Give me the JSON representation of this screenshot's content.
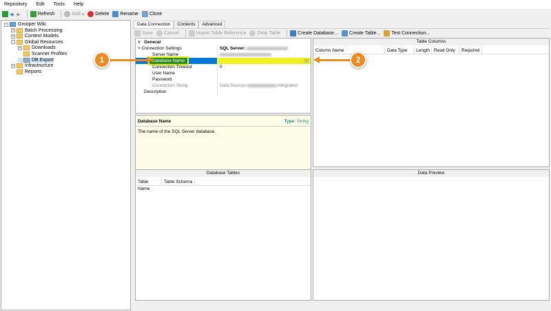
{
  "menu": [
    "Repository",
    "Edit",
    "Tools",
    "Help"
  ],
  "toolbar": {
    "refresh": "Refresh",
    "add": "Add",
    "delete": "Delete",
    "rename": "Rename",
    "clone": "Clone"
  },
  "tree": [
    {
      "label": "Grooper Wiki",
      "indent": 0,
      "pm": "-"
    },
    {
      "label": "Batch Processing",
      "indent": 1,
      "pm": "+"
    },
    {
      "label": "Content Models",
      "indent": 1,
      "pm": "+"
    },
    {
      "label": "Global Resources",
      "indent": 1,
      "pm": "-"
    },
    {
      "label": "Downloads",
      "indent": 2,
      "pm": "+"
    },
    {
      "label": "Scanner Profiles",
      "indent": 2,
      "pm": ""
    },
    {
      "label": "DB Export",
      "indent": 2,
      "pm": "",
      "selected": true
    },
    {
      "label": "Infrastructure",
      "indent": 1,
      "pm": "+"
    },
    {
      "label": "Reports",
      "indent": 1,
      "pm": ""
    }
  ],
  "tabs": [
    "Data Connection",
    "Contents",
    "Advanced"
  ],
  "actions": {
    "save": "Save",
    "cancel": "Cancel",
    "import": "Import Table Reference",
    "drop": "Drop Table",
    "create_db": "Create Database...",
    "create_table": "Create Table...",
    "test": "Test Connection..."
  },
  "props": {
    "general": "General",
    "conn_settings": "Connection Settings",
    "conn_settings_val": "SQL Server:",
    "server_name": "Server Name",
    "db_name": "Database Name",
    "timeout": "Connection Timeout",
    "timeout_val": "0",
    "user": "User Name",
    "password": "Password",
    "conn_string": "Connection String",
    "conn_string_prefix": "Data Source=",
    "conn_string_suffix": ";Integrated",
    "description": "Description"
  },
  "help": {
    "title": "Database Name",
    "type_label": "Type:",
    "type_value": "String",
    "text": "The name of the SQL Server database."
  },
  "table_columns": {
    "title": "Table Columns",
    "headers": [
      "Column Name",
      "Data Type",
      "Length",
      "Read Only",
      "Required"
    ]
  },
  "database_tables": {
    "title": "Database Tables",
    "headers": [
      "Table Name",
      "Table Schema"
    ]
  },
  "data_preview": {
    "title": "Data Preview"
  },
  "callouts": [
    "1",
    "2"
  ]
}
